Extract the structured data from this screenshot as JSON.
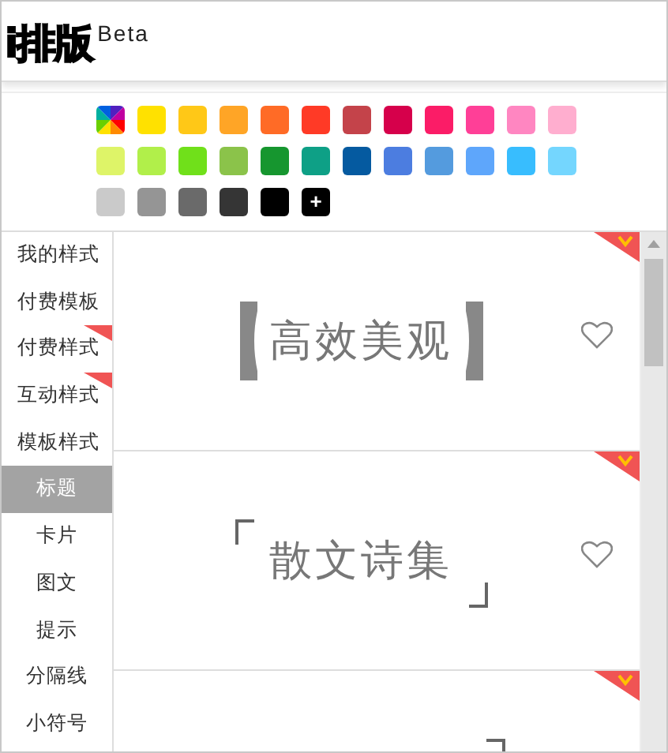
{
  "header": {
    "logo": "i排版",
    "badge": "Beta"
  },
  "palette": [
    {
      "kind": "rainbow"
    },
    {
      "kind": "color",
      "color": "#ffe100"
    },
    {
      "kind": "color",
      "color": "#ffc817"
    },
    {
      "kind": "color",
      "color": "#ffa526"
    },
    {
      "kind": "color",
      "color": "#ff6b26"
    },
    {
      "kind": "color",
      "color": "#ff3a26"
    },
    {
      "kind": "color",
      "color": "#c4434a"
    },
    {
      "kind": "color",
      "color": "#d6004b"
    },
    {
      "kind": "color",
      "color": "#fb1c67"
    },
    {
      "kind": "color",
      "color": "#ff3f97"
    },
    {
      "kind": "color",
      "color": "#ff86c1"
    },
    {
      "kind": "color",
      "color": "#ffaecf"
    },
    {
      "kind": "color",
      "color": "#def468"
    },
    {
      "kind": "color",
      "color": "#b1ef4a"
    },
    {
      "kind": "color",
      "color": "#70e01a"
    },
    {
      "kind": "color",
      "color": "#8bc34a"
    },
    {
      "kind": "color",
      "color": "#16962f"
    },
    {
      "kind": "color",
      "color": "#0ea086"
    },
    {
      "kind": "color",
      "color": "#055aa0"
    },
    {
      "kind": "color",
      "color": "#4c7de0"
    },
    {
      "kind": "color",
      "color": "#549bde"
    },
    {
      "kind": "color",
      "color": "#5ea6fb"
    },
    {
      "kind": "color",
      "color": "#38bdfe"
    },
    {
      "kind": "color",
      "color": "#74d6fe"
    },
    {
      "kind": "color",
      "color": "#cacaca"
    },
    {
      "kind": "color",
      "color": "#959595"
    },
    {
      "kind": "color",
      "color": "#6a6a6a"
    },
    {
      "kind": "color",
      "color": "#353535"
    },
    {
      "kind": "color",
      "color": "#000000"
    },
    {
      "kind": "add",
      "label": "+"
    }
  ],
  "menu": [
    {
      "kind": "section",
      "label": "我的样式",
      "selected": false,
      "flag": false
    },
    {
      "kind": "section",
      "label": "付费模板",
      "selected": false,
      "flag": false
    },
    {
      "kind": "section",
      "label": "付费样式",
      "selected": false,
      "flag": true
    },
    {
      "kind": "section",
      "label": "互动样式",
      "selected": false,
      "flag": true
    },
    {
      "kind": "section",
      "label": "模板样式",
      "selected": false,
      "flag": false
    },
    {
      "kind": "category",
      "label": "标题",
      "selected": true,
      "flag": false
    },
    {
      "kind": "category",
      "label": "卡片",
      "selected": false,
      "flag": false
    },
    {
      "kind": "category",
      "label": "图文",
      "selected": false,
      "flag": false
    },
    {
      "kind": "category",
      "label": "提示",
      "selected": false,
      "flag": false
    },
    {
      "kind": "category",
      "label": "分隔线",
      "selected": false,
      "flag": false
    },
    {
      "kind": "category",
      "label": "小符号",
      "selected": false,
      "flag": false
    }
  ],
  "cards": [
    {
      "kind": "heavy-bracket",
      "title": "高效美观",
      "vip": true,
      "favorited": false
    },
    {
      "kind": "corner-bracket",
      "title": "散文诗集",
      "vip": true,
      "favorited": false
    },
    {
      "kind": "partial",
      "vip": true
    }
  ]
}
